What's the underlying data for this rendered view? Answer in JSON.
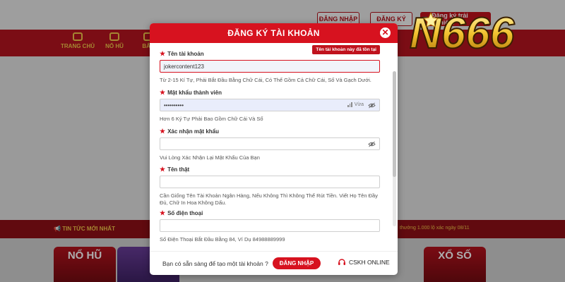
{
  "header": {
    "login_label": "ĐĂNG NHẬP",
    "signup_label": "ĐĂNG KÝ",
    "trial_label": "Đăng ký trải nghiệm"
  },
  "nav": {
    "items": [
      {
        "label": "TRANG CHỦ"
      },
      {
        "label": "NỔ HŨ"
      },
      {
        "label": "BẮN"
      }
    ]
  },
  "logo": {
    "text": "N666"
  },
  "ticker": {
    "label": "TIN TỨC MỚI NHẤT",
    "text": "thưởng 1.000 lộ xác ngày 08/11"
  },
  "games": [
    {
      "label": "NỔ HŨ"
    },
    {
      "label": ""
    },
    {
      "label": ""
    },
    {
      "label": "XỔ SỐ"
    }
  ],
  "modal": {
    "title": "ĐĂNG KÝ TÀI KHOẢN",
    "close_icon": "close-icon",
    "fields": {
      "username": {
        "label": "Tên tài khoản",
        "value": "jokercontent123",
        "error": "Tên tài khoản này đã tồn tại",
        "hint": "Từ 2-15 Kí Tự, Phải Bắt Đầu Bằng Chữ Cái, Có Thể Gồm Cả Chữ Cái, Số Và Gạch Dưới."
      },
      "password": {
        "label": "Mật khẩu thành viên",
        "value": "••••••••••",
        "strength": "Vừa",
        "hint": "Hơn 6 Ký Tự Phải Bao Gồm Chữ Cái Và Số"
      },
      "confirm": {
        "label": "Xác nhận mật khẩu",
        "value": "",
        "hint": "Vui Lòng Xác Nhận Lại Mật Khẩu Của Bạn"
      },
      "realname": {
        "label": "Tên thật",
        "value": "",
        "hint": "Cần Giống Tên Tài Khoản Ngân Hàng, Nếu Không Thì Không Thể Rút Tiền. Viết Họ Tên Đầy Đủ, Chữ In Hoa Không Dấu."
      },
      "phone": {
        "label": "Số điện thoại",
        "value": "",
        "hint": "Số Điện Thoại Bắt Đầu Bằng 84, Ví Dụ 84988889999"
      }
    },
    "footer": {
      "question": "Bạn có sẵn sàng để tạo một tài khoản ?",
      "login_label": "ĐĂNG NHẬP",
      "support_label": "CSKH ONLINE"
    }
  },
  "colors": {
    "brand_red": "#d7121f",
    "nav_red": "#b51420",
    "gold": "#f3c64a"
  }
}
